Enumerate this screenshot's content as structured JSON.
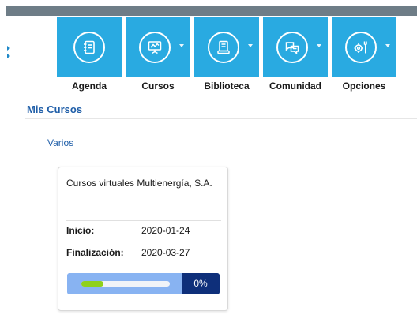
{
  "nav": {
    "items": [
      {
        "label": "Agenda",
        "icon": "agenda-icon",
        "has_dropdown": false
      },
      {
        "label": "Cursos",
        "icon": "presentation-board-icon",
        "has_dropdown": true
      },
      {
        "label": "Biblioteca",
        "icon": "book-icon",
        "has_dropdown": true
      },
      {
        "label": "Comunidad",
        "icon": "chat-bubbles-icon",
        "has_dropdown": true
      },
      {
        "label": "Opciones",
        "icon": "gear-wrench-icon",
        "has_dropdown": true
      }
    ]
  },
  "section": {
    "title": "Mis Cursos"
  },
  "category": {
    "label": "Varios"
  },
  "course": {
    "title": "Cursos virtuales Multienergía, S.A.",
    "start_label": "Inicio:",
    "start_date": "2020-01-24",
    "end_label": "Finalización:",
    "end_date": "2020-03-27",
    "progress_percent": 0,
    "progress_label": "0%"
  },
  "colors": {
    "nav_tile": "#29aae1",
    "section_title": "#1f5ea8",
    "progress_bg": "#88b3f2",
    "progress_fill": "#8fd11c",
    "progress_badge": "#0e2f7a"
  }
}
